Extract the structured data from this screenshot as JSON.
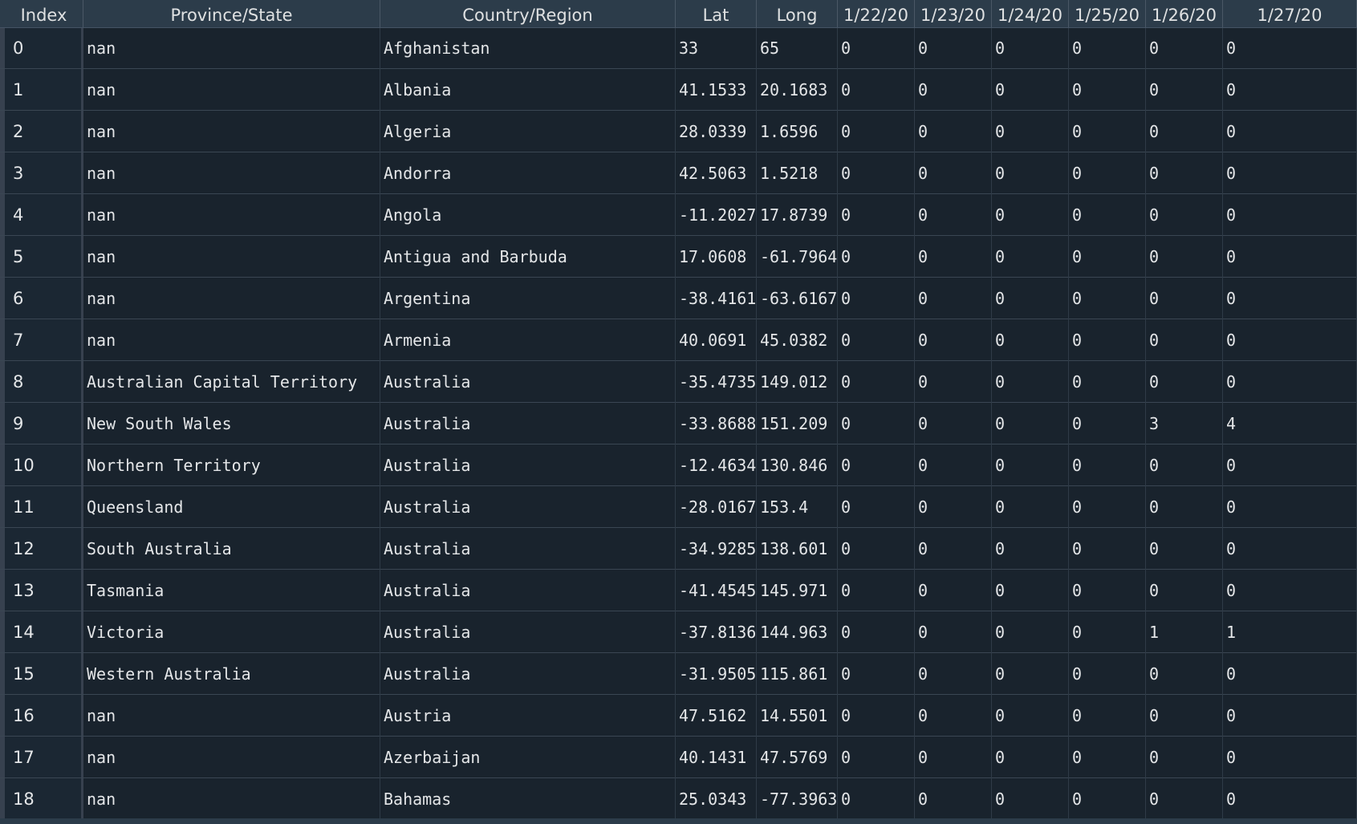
{
  "columns": [
    "Index",
    "Province/State",
    "Country/Region",
    "Lat",
    "Long",
    "1/22/20",
    "1/23/20",
    "1/24/20",
    "1/25/20",
    "1/26/20",
    "1/27/20"
  ],
  "rows": [
    [
      "0",
      "nan",
      "Afghanistan",
      "33",
      "65",
      "0",
      "0",
      "0",
      "0",
      "0",
      "0"
    ],
    [
      "1",
      "nan",
      "Albania",
      "41.1533",
      "20.1683",
      "0",
      "0",
      "0",
      "0",
      "0",
      "0"
    ],
    [
      "2",
      "nan",
      "Algeria",
      "28.0339",
      "1.6596",
      "0",
      "0",
      "0",
      "0",
      "0",
      "0"
    ],
    [
      "3",
      "nan",
      "Andorra",
      "42.5063",
      "1.5218",
      "0",
      "0",
      "0",
      "0",
      "0",
      "0"
    ],
    [
      "4",
      "nan",
      "Angola",
      "-11.2027",
      "17.8739",
      "0",
      "0",
      "0",
      "0",
      "0",
      "0"
    ],
    [
      "5",
      "nan",
      "Antigua and Barbuda",
      "17.0608",
      "-61.7964",
      "0",
      "0",
      "0",
      "0",
      "0",
      "0"
    ],
    [
      "6",
      "nan",
      "Argentina",
      "-38.4161",
      "-63.6167",
      "0",
      "0",
      "0",
      "0",
      "0",
      "0"
    ],
    [
      "7",
      "nan",
      "Armenia",
      "40.0691",
      "45.0382",
      "0",
      "0",
      "0",
      "0",
      "0",
      "0"
    ],
    [
      "8",
      "Australian Capital Territory",
      "Australia",
      "-35.4735",
      "149.012",
      "0",
      "0",
      "0",
      "0",
      "0",
      "0"
    ],
    [
      "9",
      "New South Wales",
      "Australia",
      "-33.8688",
      "151.209",
      "0",
      "0",
      "0",
      "0",
      "3",
      "4"
    ],
    [
      "10",
      "Northern Territory",
      "Australia",
      "-12.4634",
      "130.846",
      "0",
      "0",
      "0",
      "0",
      "0",
      "0"
    ],
    [
      "11",
      "Queensland",
      "Australia",
      "-28.0167",
      "153.4",
      "0",
      "0",
      "0",
      "0",
      "0",
      "0"
    ],
    [
      "12",
      "South Australia",
      "Australia",
      "-34.9285",
      "138.601",
      "0",
      "0",
      "0",
      "0",
      "0",
      "0"
    ],
    [
      "13",
      "Tasmania",
      "Australia",
      "-41.4545",
      "145.971",
      "0",
      "0",
      "0",
      "0",
      "0",
      "0"
    ],
    [
      "14",
      "Victoria",
      "Australia",
      "-37.8136",
      "144.963",
      "0",
      "0",
      "0",
      "0",
      "1",
      "1"
    ],
    [
      "15",
      "Western Australia",
      "Australia",
      "-31.9505",
      "115.861",
      "0",
      "0",
      "0",
      "0",
      "0",
      "0"
    ],
    [
      "16",
      "nan",
      "Austria",
      "47.5162",
      "14.5501",
      "0",
      "0",
      "0",
      "0",
      "0",
      "0"
    ],
    [
      "17",
      "nan",
      "Azerbaijan",
      "40.1431",
      "47.5769",
      "0",
      "0",
      "0",
      "0",
      "0",
      "0"
    ],
    [
      "18",
      "nan",
      "Bahamas",
      "25.0343",
      "-77.3963",
      "0",
      "0",
      "0",
      "0",
      "0",
      "0"
    ]
  ],
  "colors": {
    "background": "#19232d",
    "header": "#2c3c4a",
    "text": "#e4e6e8"
  }
}
